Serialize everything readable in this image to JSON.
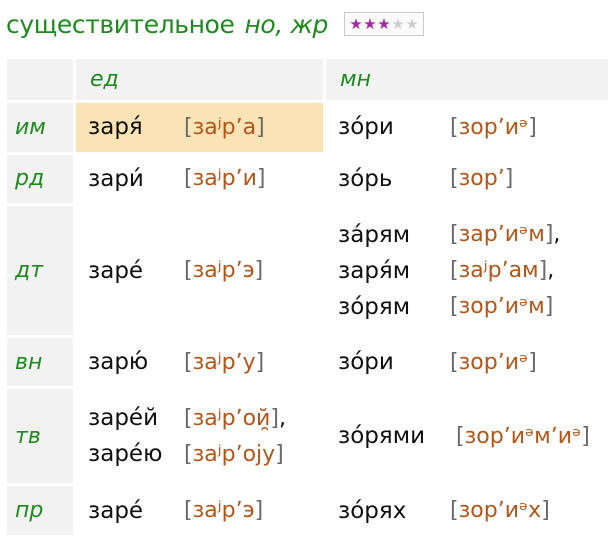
{
  "header": {
    "title": "существительное",
    "grammar": "но, жр",
    "rating": {
      "filled": 3,
      "total": 5,
      "filled_color": "#a42aa4",
      "empty_color": "#cfcfcf"
    }
  },
  "table": {
    "columns": [
      "ед",
      "мн"
    ],
    "rows": [
      {
        "case": "им",
        "singular": [
          {
            "form": "заря́",
            "tr": "заʲрʼа",
            "punct": ""
          }
        ],
        "plural": [
          {
            "form": "зо́ри",
            "tr": "зорʼиᵊ",
            "punct": ""
          }
        ]
      },
      {
        "case": "рд",
        "singular": [
          {
            "form": "зари́",
            "tr": "заʲрʼи",
            "punct": ""
          }
        ],
        "plural": [
          {
            "form": "зо́рь",
            "tr": "зорʼ",
            "punct": ""
          }
        ]
      },
      {
        "case": "дт",
        "singular": [
          {
            "form": "заре́",
            "tr": "заʲрʼэ",
            "punct": ""
          }
        ],
        "plural": [
          {
            "form": "за́рям",
            "tr": "зарʼиᵊм",
            "punct": ","
          },
          {
            "form": "заря́м",
            "tr": "заʲрʼам",
            "punct": ","
          },
          {
            "form": "зо́рям",
            "tr": "зорʼиᵊм",
            "punct": ""
          }
        ]
      },
      {
        "case": "вн",
        "singular": [
          {
            "form": "зарю́",
            "tr": "заʲрʼу",
            "punct": ""
          }
        ],
        "plural": [
          {
            "form": "зо́ри",
            "tr": "зорʼиᵊ",
            "punct": ""
          }
        ]
      },
      {
        "case": "тв",
        "singular": [
          {
            "form": "заре́й",
            "tr": "заʲрʼой̯",
            "punct": ","
          },
          {
            "form": "заре́ю",
            "tr": "заʲрʼоjу",
            "punct": ""
          }
        ],
        "plural": [
          {
            "form": "зо́рями",
            "tr": "зорʼиᵊмʼиᵊ",
            "punct": ""
          }
        ]
      },
      {
        "case": "пр",
        "singular": [
          {
            "form": "заре́",
            "tr": "заʲрʼэ",
            "punct": ""
          }
        ],
        "plural": [
          {
            "form": "зо́рях",
            "tr": "зорʼиᵊх",
            "punct": ""
          }
        ]
      }
    ],
    "highlight_color": "#fae3b4",
    "header_bg": "#f2f2f2",
    "label_color": "#1f8a1f",
    "transcription_color": "#b3561a"
  }
}
